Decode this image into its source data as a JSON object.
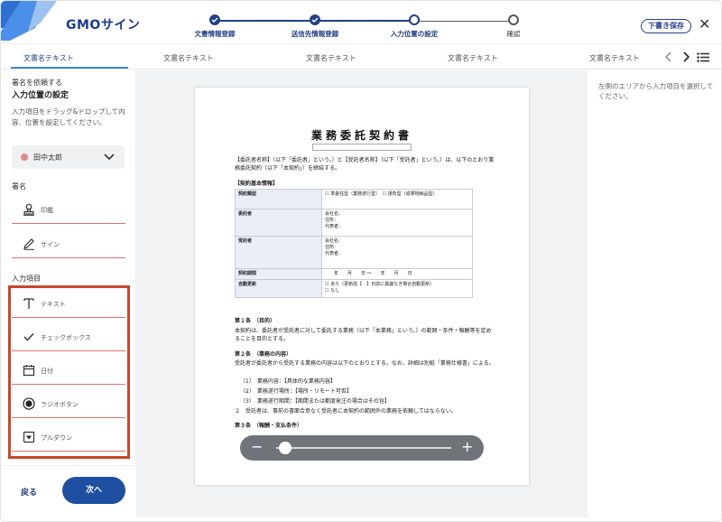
{
  "header": {
    "logo_text": "GMOサイン",
    "draft_label": "下書き保存",
    "close_label": "✕",
    "brand_color": "#233f85"
  },
  "stepper": {
    "steps": [
      {
        "label": "文書情報登録",
        "state": "done"
      },
      {
        "label": "送信先情報登録",
        "state": "done"
      },
      {
        "label": "入力位置の設定",
        "state": "current"
      },
      {
        "label": "確認",
        "state": "pending"
      }
    ]
  },
  "tabs": {
    "items": [
      {
        "label": "文書名テキスト",
        "active": true
      },
      {
        "label": "文書名テキスト",
        "active": false
      },
      {
        "label": "文書名テキスト",
        "active": false
      },
      {
        "label": "文書名テキスト",
        "active": false
      },
      {
        "label": "文書名テキスト",
        "active": false
      }
    ],
    "prev_icon": "chevron-left-icon",
    "next_icon": "chevron-right-icon",
    "list_icon": "list-icon"
  },
  "sidebar": {
    "title1": "署名を依頼する",
    "title2": "入力位置の設定",
    "description": "入力項目をドラッグ&ドロップして内容、位置を設定してください。",
    "signer_name": "田中太郎",
    "signature_section": "署名",
    "signature_items": [
      {
        "label": "印鑑",
        "icon": "stamp-icon"
      },
      {
        "label": "サイン",
        "icon": "pen-icon"
      }
    ],
    "input_section": "入力項目",
    "input_items": [
      {
        "label": "テキスト",
        "icon": "text-icon"
      },
      {
        "label": "チェックボックス",
        "icon": "checkmark-icon"
      },
      {
        "label": "日付",
        "icon": "calendar-icon"
      },
      {
        "label": "ラジオボタン",
        "icon": "radio-icon"
      },
      {
        "label": "プルダウン",
        "icon": "dropdown-icon"
      }
    ],
    "highlight_color": "#c9462b"
  },
  "footer": {
    "back_label": "戻る",
    "next_label": "次へ"
  },
  "document": {
    "title": "業務委託契約書",
    "intro": "【委託者名称】（以下「委託者」という。）と【受託者名称】（以下「受託者」という。）は、以下のとおり業務委託契約（以下「本契約」）を締結する。",
    "basic_info_heading": "【契約基本情報】",
    "table": [
      {
        "key": "契約類型",
        "value": "☐ 準委任型（業務遂行型）　☐ 請負型（成果物納品型）"
      },
      {
        "key": "委託者",
        "value": "会社名：\n住所：\n代表者："
      },
      {
        "key": "受託者",
        "value": "会社名：\n住所：\n代表者："
      },
      {
        "key": "契約期間",
        "value": "　　年　　月　　日 〜　　年　　月　　日"
      },
      {
        "key": "自動更新",
        "value": "☐ あり（更新前【　】日前に異議なき場合自動更新）\n☐ なし"
      }
    ],
    "article1_heading": "第１条　（目的）",
    "article1_body": "本契約は、委託者が受託者に対して委託する業務（以下「本業務」という。）の範囲・条件・報酬等を定めることを目的とする。",
    "article2_heading": "第２条　（業務の内容）",
    "article2_body": "受託者が委託者から受託する業務の内容は以下のとおりとする。なお、詳細は別紙「業務仕様書」による。",
    "article2_items": [
      "（1）　業務内容：【具体的な業務内容】",
      "（2）　業務遂行場所：【場所・リモート可否】",
      "（3）　業務遂行期間：【期間または都度発注の場合はその旨】"
    ],
    "article2_note": "２　受託者は、事前の書面合意なく受託者に本契約の範囲外の業務を依頼してはならない。",
    "article3_heading": "第３条　（報酬・支払条件）"
  },
  "zoom": {
    "minus": "−",
    "plus": "+",
    "level": 0.05
  },
  "right_panel": {
    "hint": "左側のエリアから入力項目を選択してください。"
  }
}
